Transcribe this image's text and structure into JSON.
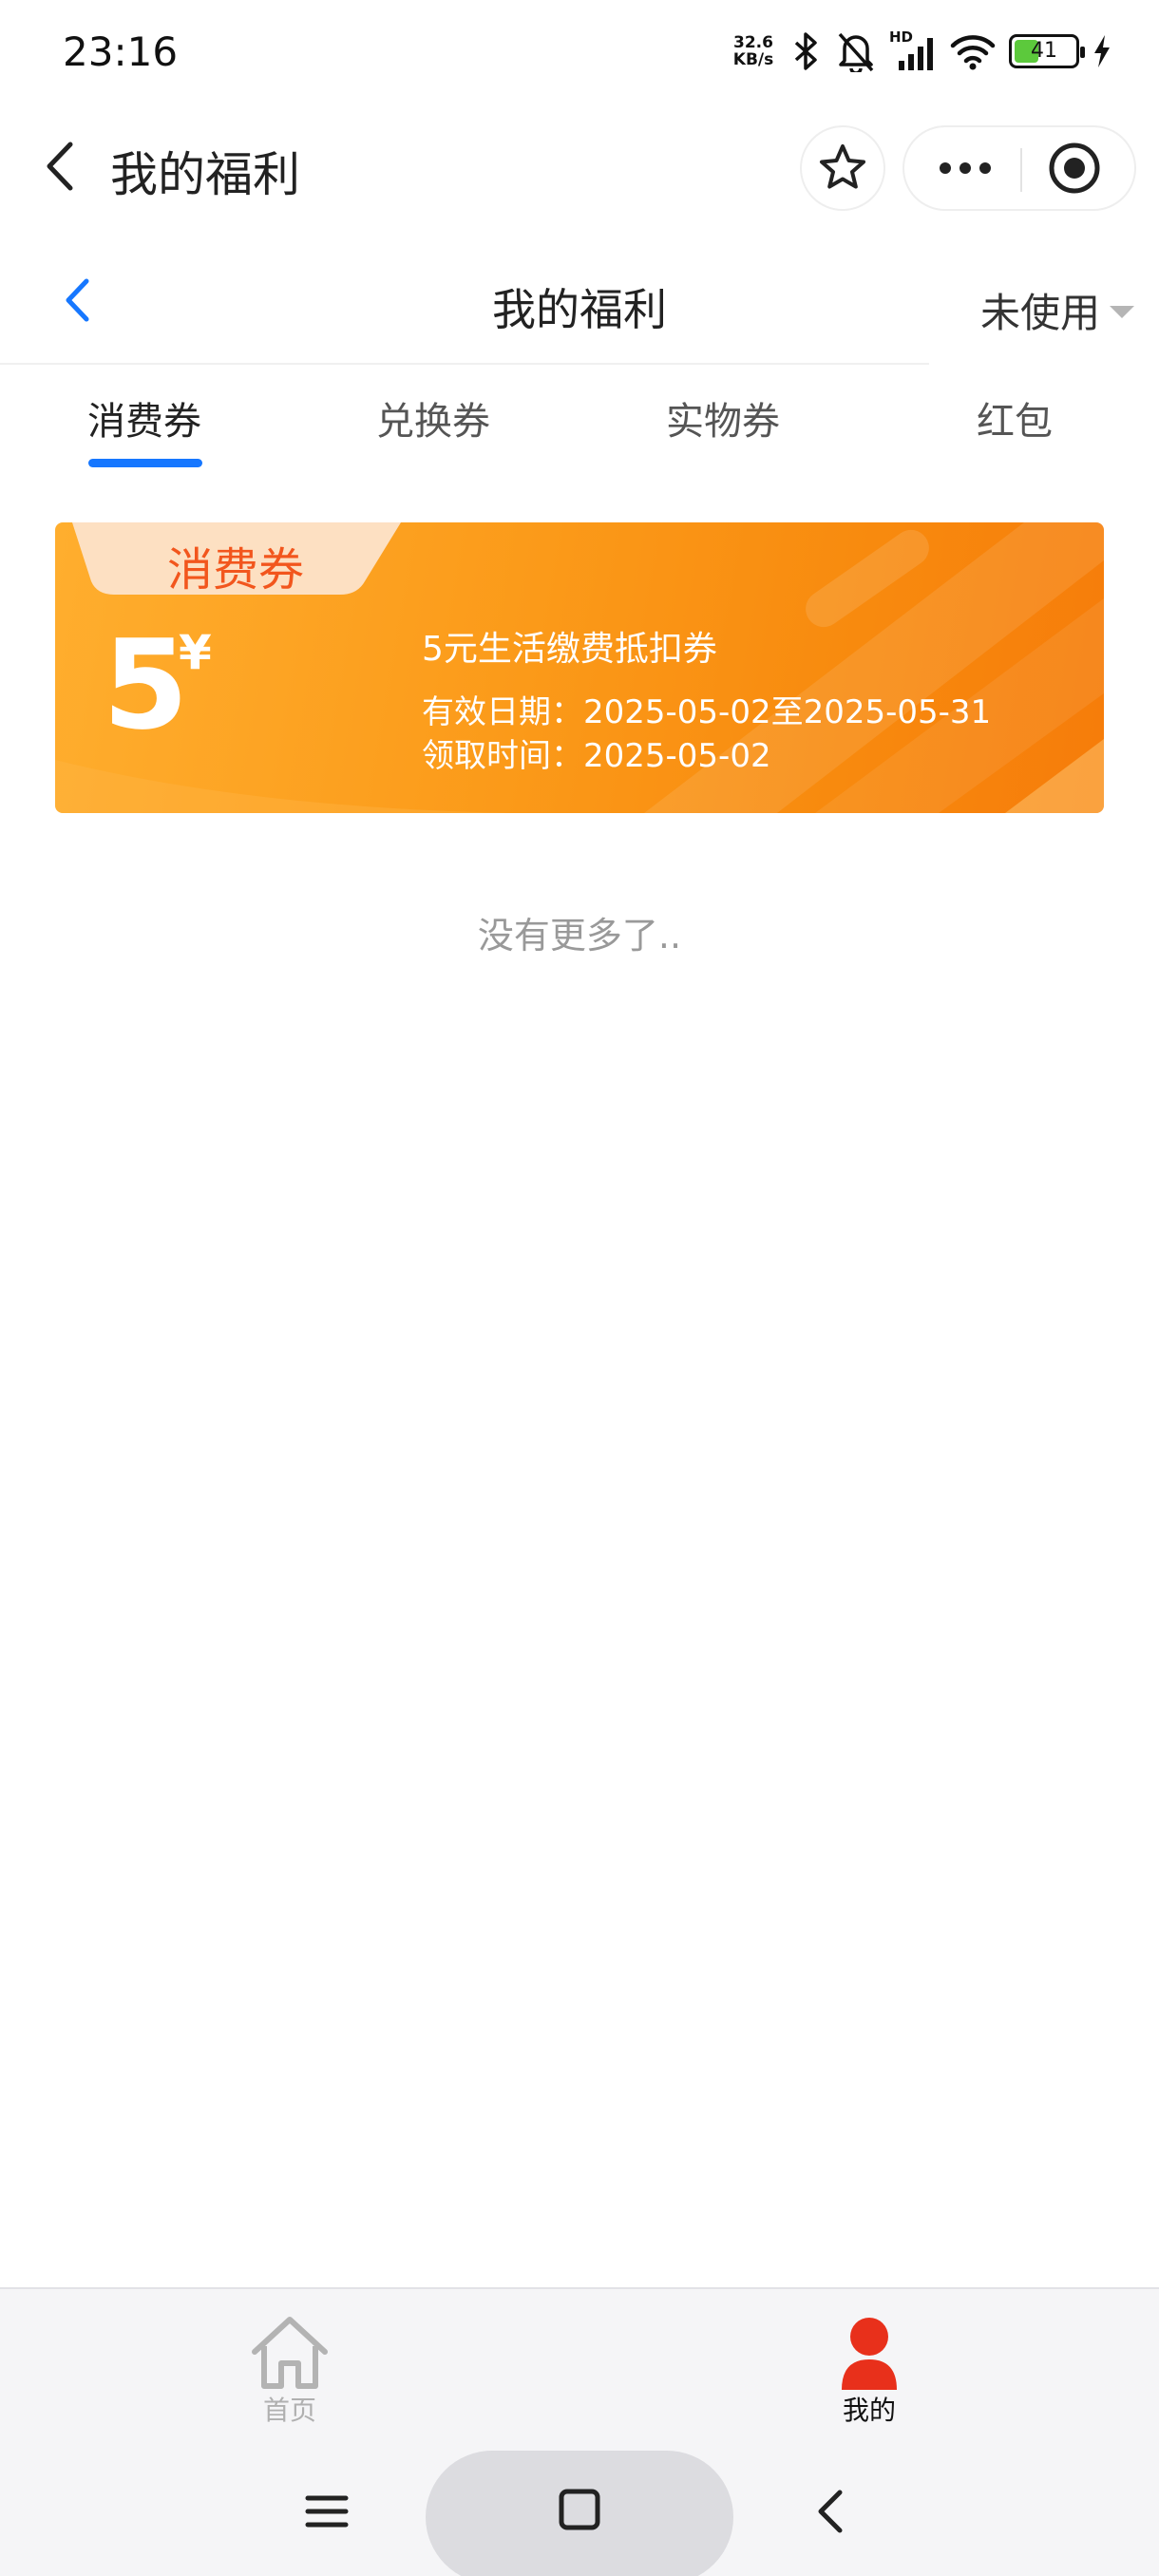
{
  "status_bar": {
    "time": "23:16",
    "net_speed_value": "32.6",
    "net_speed_unit": "KB/s",
    "signal_label": "HD",
    "battery_level": "41",
    "battery_fraction": 0.41,
    "icons": [
      "bluetooth-icon",
      "mute-bell-icon",
      "signal-icon",
      "wifi-icon",
      "battery-icon",
      "charging-icon"
    ]
  },
  "navbar": {
    "title": "我的福利",
    "icons": [
      "back-arrow-icon",
      "star-icon",
      "more-dots-icon",
      "target-icon"
    ]
  },
  "page_header": {
    "title": "我的福利",
    "filter_label": "未使用",
    "accent_color": "#1677ff"
  },
  "tabs": [
    {
      "label": "消费券",
      "active": true
    },
    {
      "label": "兑换券",
      "active": false
    },
    {
      "label": "实物券",
      "active": false
    },
    {
      "label": "红包",
      "active": false
    }
  ],
  "coupon": {
    "tag": "消费券",
    "amount": "5",
    "currency": "¥",
    "name": "5元生活缴费抵扣券",
    "validity": "有效日期：2025-05-02至2025-05-31",
    "received": "领取时间：2025-05-02",
    "color": "#f88a0e"
  },
  "list_end_text": "没有更多了..",
  "bottom_tabs": [
    {
      "label": "首页",
      "icon": "home-icon",
      "active": false
    },
    {
      "label": "我的",
      "icon": "user-icon",
      "active": true,
      "color": "#e8301b"
    }
  ],
  "system_nav": {
    "icons": [
      "menu-icon",
      "home-square-icon",
      "back-icon"
    ]
  }
}
